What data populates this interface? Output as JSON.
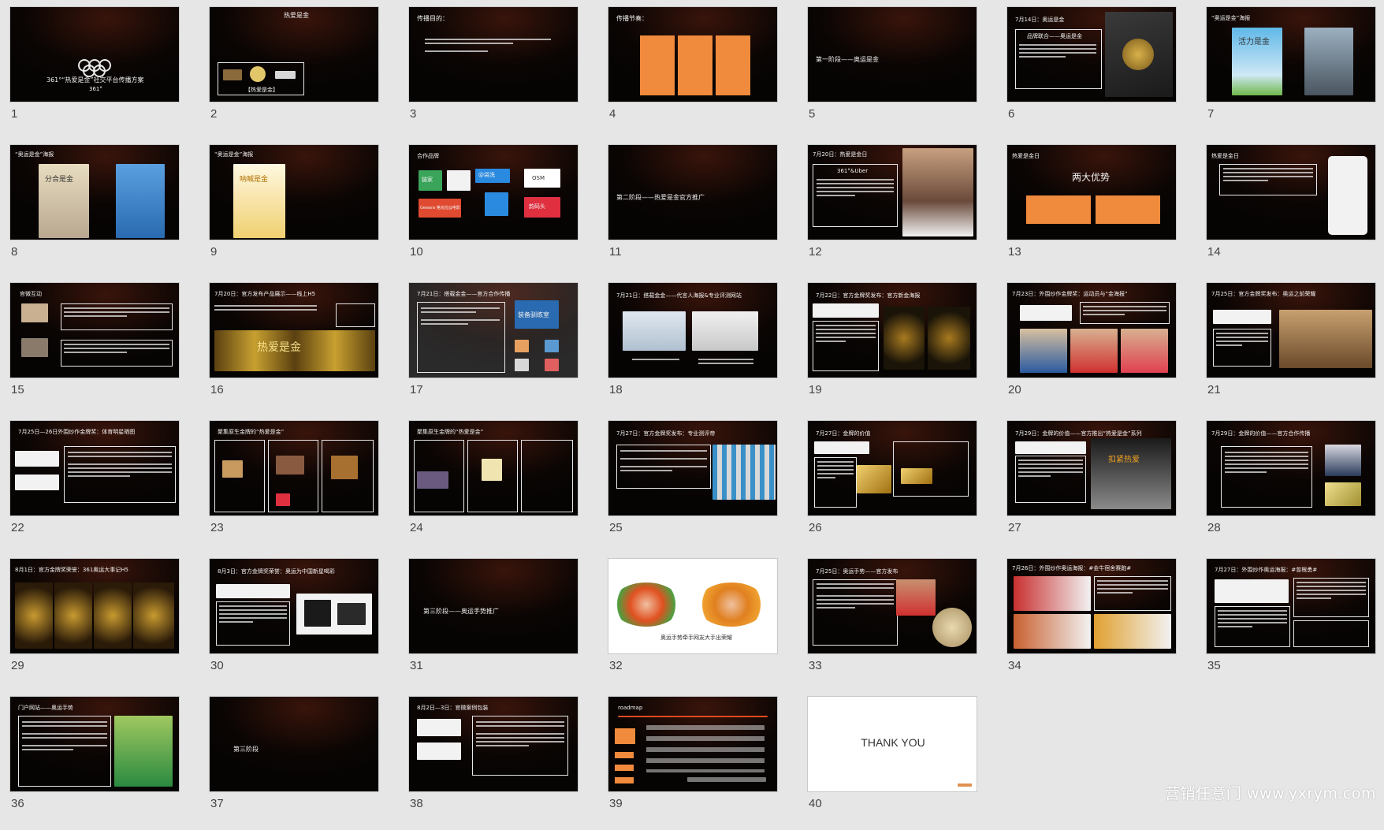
{
  "slides": [
    {
      "num": "1",
      "title": "361°“热爱是金”社交平台传播方案",
      "subtitle": "361°"
    },
    {
      "num": "2",
      "title": "热爱是金",
      "caption": "【热爱是金】"
    },
    {
      "num": "3",
      "title": "传播目的："
    },
    {
      "num": "4",
      "title": "传播节奏："
    },
    {
      "num": "5",
      "title": "第一阶段——奥运是金"
    },
    {
      "num": "6",
      "title": "7月14日：奥运是金",
      "caption": "品牌联合——奥运是金"
    },
    {
      "num": "7",
      "title": "“奥运是金”海报",
      "caption": "活力是金"
    },
    {
      "num": "8",
      "title": "“奥运是金”海报",
      "caption": "分合是金"
    },
    {
      "num": "9",
      "title": "“奥运是金”海报",
      "caption": "呐喊是金"
    },
    {
      "num": "10",
      "title": "合作品牌",
      "logos": [
        "链家",
        "@袋洗",
        "OSM",
        "Gewara 格瓦拉@电影",
        "韵码头"
      ]
    },
    {
      "num": "11",
      "title": "第二阶段——热爱是金官方推广"
    },
    {
      "num": "12",
      "title": "7月20日：热爱是金日",
      "caption": "361°&Uber"
    },
    {
      "num": "13",
      "title": "热爱是金日",
      "caption": "两大优势"
    },
    {
      "num": "14",
      "title": "热爱是金日"
    },
    {
      "num": "15",
      "title": "官微互动"
    },
    {
      "num": "16",
      "title": "7月20日：官方发布产品展示——线上H5",
      "caption": "热爱是金"
    },
    {
      "num": "17",
      "title": "7月21日：搭载金金——官方合作传播",
      "caption": "装备驯练室"
    },
    {
      "num": "18",
      "title": "7月21日：搭载金金——代言人海报&专业评测网站"
    },
    {
      "num": "19",
      "title": "7月22日：官方金牌奖发布：官方新金海报"
    },
    {
      "num": "20",
      "title": "7月23日：外围炒作金牌奖：运动员与“金海报”"
    },
    {
      "num": "21",
      "title": "7月25日：官方金牌奖发布：奥运之前荣耀"
    },
    {
      "num": "22",
      "title": "7月25日—26日外围炒作金牌奖：体育明星晒图"
    },
    {
      "num": "23",
      "title": "聚集原生金牌的“热爱是金”"
    },
    {
      "num": "24",
      "title": "聚集原生金牌的“热爱是金”"
    },
    {
      "num": "25",
      "title": "7月27日：官方金牌奖发布：专业测评帝"
    },
    {
      "num": "26",
      "title": "7月27日：金牌的价值"
    },
    {
      "num": "27",
      "title": "7月29日：金牌的价值——官方推出“热爱是金”系列",
      "caption": "扣紧热爱"
    },
    {
      "num": "28",
      "title": "7月29日：金牌的价值——官方合作传播"
    },
    {
      "num": "29",
      "title": "8月1日：官方金牌奖荣誉：361奥运大事记H5"
    },
    {
      "num": "30",
      "title": "8月3日：官方金牌奖荣誉：奥运为中国新星喝彩"
    },
    {
      "num": "31",
      "title": "第三阶段——奥运手势推广"
    },
    {
      "num": "32",
      "title": "",
      "caption": "奥运手势牵手网友大手出荣耀"
    },
    {
      "num": "33",
      "title": "7月25日：奥运手势——官方发布"
    },
    {
      "num": "34",
      "title": "7月26日：外围炒作奥运海报：#金牛宿舍赛跑#"
    },
    {
      "num": "35",
      "title": "7月27日：外围炒作奥运海报：#曾根勇#"
    },
    {
      "num": "36",
      "title": "门户网站——奥运手势"
    },
    {
      "num": "37",
      "title": "第三阶段"
    },
    {
      "num": "38",
      "title": "8月2日—3日：官微案例包装"
    },
    {
      "num": "39",
      "title": "roadmap"
    },
    {
      "num": "40",
      "title": "THANK YOU"
    }
  ],
  "watermark": "营销任意门 www.yxrym.com"
}
